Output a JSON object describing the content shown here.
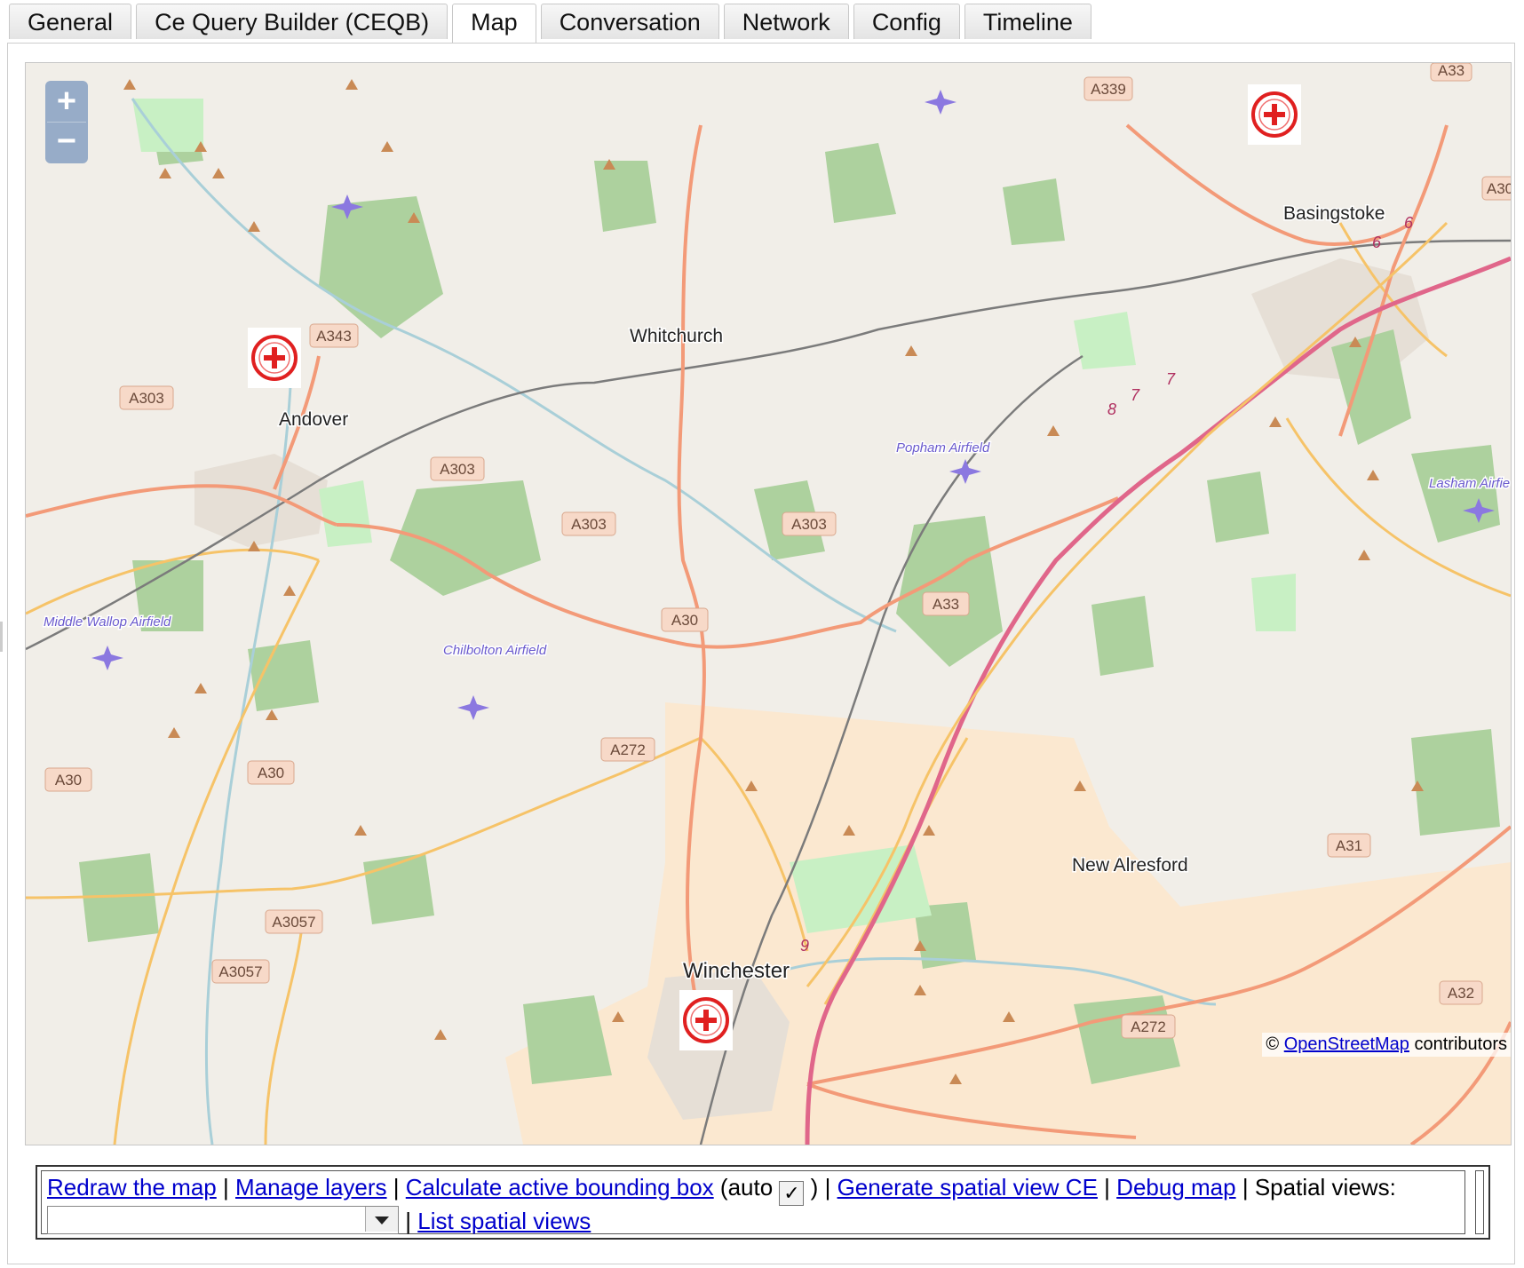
{
  "tabs": [
    "General",
    "Ce Query Builder (CEQB)",
    "Map",
    "Conversation",
    "Network",
    "Config",
    "Timeline"
  ],
  "active_tab": "Map",
  "map": {
    "zoom_in": "+",
    "zoom_out": "−",
    "places": [
      "Whitchurch",
      "Andover",
      "Basingstoke",
      "New Alresford",
      "Winchester"
    ],
    "airfields": [
      "Popham Airfield",
      "Lasham Airfie",
      "Middle Wallop Airfield",
      "Chilbolton Airfield"
    ],
    "road_labels": [
      "A339",
      "A33",
      "A30",
      "A343",
      "A303",
      "A303",
      "A303",
      "A303",
      "A33",
      "A30",
      "A272",
      "A30",
      "A30",
      "A3057",
      "A3057",
      "A31",
      "A32",
      "A272"
    ],
    "junctions": [
      "6",
      "6",
      "7",
      "7",
      "8",
      "9"
    ],
    "markers": [
      "marker-andover",
      "marker-basingstoke",
      "marker-winchester"
    ],
    "attribution": {
      "prefix": "©",
      "link": "OpenStreetMap",
      "suffix": "contributors"
    }
  },
  "controls": {
    "redraw": "Redraw the map",
    "manage_layers": "Manage layers",
    "calc_bbox": "Calculate active bounding box",
    "auto_label": "(auto",
    "auto_checked": true,
    "auto_close": ")",
    "generate_ce": "Generate spatial view CE",
    "debug_map": "Debug map",
    "spatial_views_label": "Spatial views:",
    "spatial_views_value": "",
    "list_spatial": "List spatial views",
    "separator": "|"
  },
  "colors": {
    "background": "#f1eee8",
    "wood": "#add19e",
    "primary_road": "#f39a78",
    "motorway": "#e06a8a",
    "secondary_road": "#f6c368",
    "railway": "#777777",
    "marker_ring": "#e02020"
  }
}
